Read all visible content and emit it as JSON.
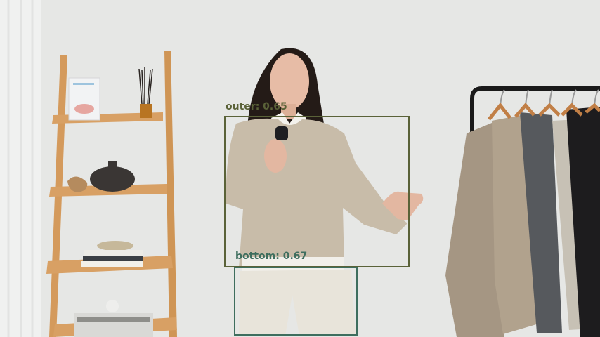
{
  "detections": [
    {
      "label": "outer",
      "score": "0.65",
      "color": "#5a6238"
    },
    {
      "label": "bottom",
      "score": "0.67",
      "color": "#3e6e5e"
    }
  ],
  "colors": {
    "wall": "#e6e7e5",
    "wood": "#d49a5c",
    "sweater": "#c8bca9",
    "trousers": "#e8e4da",
    "hair": "#241b17",
    "coat_taupe": "#a59683",
    "coat_gray": "#56595d",
    "coat_light": "#c7c1b5",
    "coat_black": "#1d1c1e",
    "rack": "#1a1a1a"
  }
}
